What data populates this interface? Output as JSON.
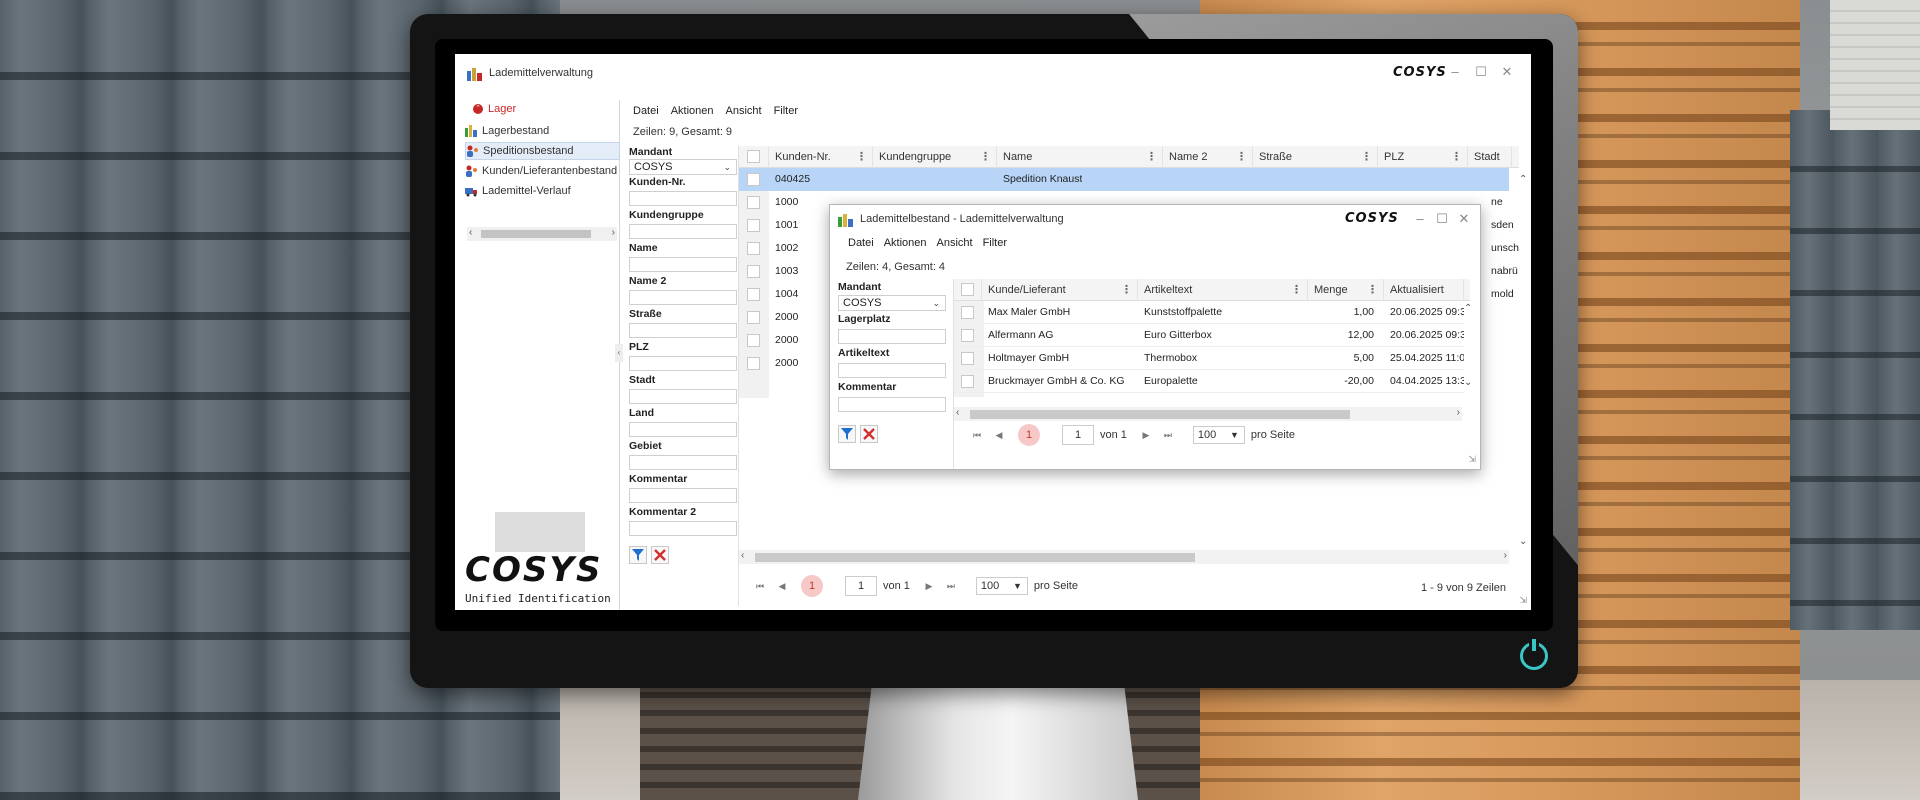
{
  "main_window": {
    "title": "Lademittelverwaltung",
    "brand": "COSYS",
    "nav": {
      "header": "Lager",
      "items": [
        {
          "label": "Lagerbestand"
        },
        {
          "label": "Speditionsbestand"
        },
        {
          "label": "Kunden/Lieferantenbestand"
        },
        {
          "label": "Lademittel-Verlauf"
        }
      ]
    },
    "logo": {
      "text": "COSYS",
      "subtitle": "Unified Identification"
    },
    "menu": [
      "Datei",
      "Aktionen",
      "Ansicht",
      "Filter"
    ],
    "row_count": "Zeilen: 9, Gesamt: 9",
    "filters": {
      "mandant_label": "Mandant",
      "mandant_value": "COSYS",
      "fields": [
        "Kunden-Nr.",
        "Kundengruppe",
        "Name",
        "Name 2",
        "Straße",
        "PLZ",
        "Stadt",
        "Land",
        "Gebiet",
        "Kommentar",
        "Kommentar 2"
      ]
    },
    "grid": {
      "columns": [
        "Kunden-Nr.",
        "Kundengruppe",
        "Name",
        "Name 2",
        "Straße",
        "PLZ",
        "Stadt"
      ],
      "rows": [
        {
          "nr": "040425",
          "name": "Spedition Knaust",
          "stadt": "",
          "selected": true
        },
        {
          "nr": "1000",
          "name": "",
          "stadt": "ne"
        },
        {
          "nr": "1001",
          "name": "",
          "stadt": "sden"
        },
        {
          "nr": "1002",
          "name": "",
          "stadt": "unsch"
        },
        {
          "nr": "1003",
          "name": "",
          "stadt": "nabrü"
        },
        {
          "nr": "1004",
          "name": "",
          "stadt": "mold"
        },
        {
          "nr": "2000",
          "name": "",
          "stadt": ""
        },
        {
          "nr": "2000",
          "name": "",
          "stadt": ""
        },
        {
          "nr": "2000",
          "name": "",
          "stadt": ""
        }
      ]
    },
    "pager": {
      "current": "1",
      "page_input": "1",
      "of_label": "von 1",
      "page_size": "100",
      "per_page_label": "pro Seite",
      "summary": "1 - 9 von 9 Zeilen"
    }
  },
  "dialog": {
    "title": "Lademittelbestand - Lademittelverwaltung",
    "brand": "COSYS",
    "menu": [
      "Datei",
      "Aktionen",
      "Ansicht",
      "Filter"
    ],
    "row_count": "Zeilen: 4, Gesamt: 4",
    "filters": {
      "mandant_label": "Mandant",
      "mandant_value": "COSYS",
      "fields": [
        "Lagerplatz",
        "Artikeltext",
        "Kommentar"
      ]
    },
    "grid": {
      "columns": [
        "Kunde/Lieferant",
        "Artikeltext",
        "Menge",
        "Aktualisiert"
      ],
      "rows": [
        {
          "kunde": "Max Maler GmbH",
          "artikel": "Kunststoffpalette",
          "menge": "1,00",
          "aktualisiert": "20.06.2025 09:3"
        },
        {
          "kunde": "Alfermann AG",
          "artikel": "Euro Gitterbox",
          "menge": "12,00",
          "aktualisiert": "20.06.2025 09:3"
        },
        {
          "kunde": "Holtmayer GmbH",
          "artikel": "Thermobox",
          "menge": "5,00",
          "aktualisiert": "25.04.2025 11:0"
        },
        {
          "kunde": "Bruckmayer GmbH & Co. KG",
          "artikel": "Europalette",
          "menge": "-20,00",
          "aktualisiert": "04.04.2025 13:3"
        }
      ]
    },
    "pager": {
      "current": "1",
      "page_input": "1",
      "of_label": "von 1",
      "page_size": "100",
      "per_page_label": "pro Seite"
    }
  },
  "colors": {
    "accent_red": "#c62828",
    "selection_blue": "#b8d4f6",
    "power_teal": "#3ac6c6"
  }
}
